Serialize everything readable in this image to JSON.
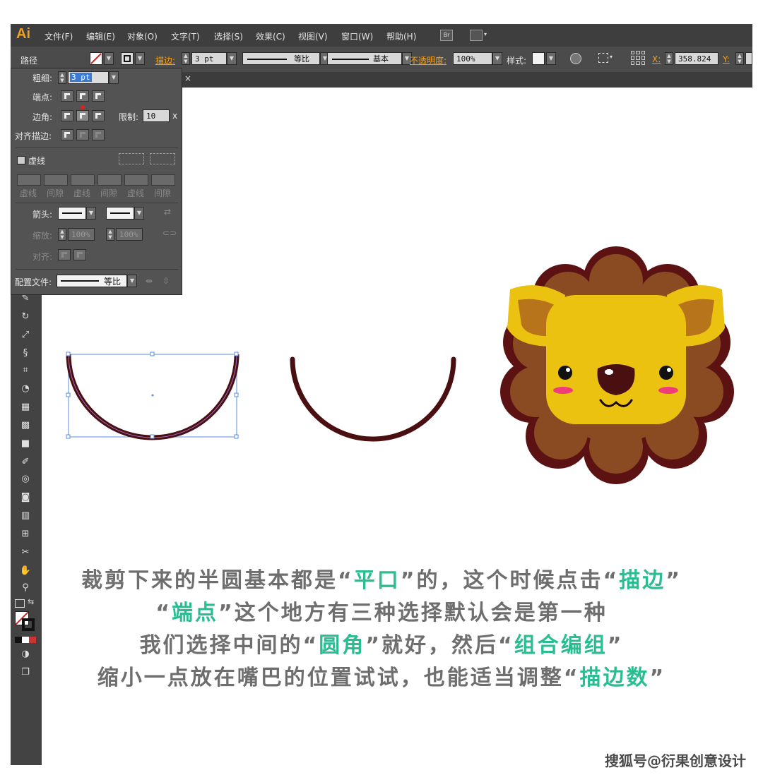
{
  "app": {
    "logo": "Ai",
    "menus": [
      "文件(F)",
      "编辑(E)",
      "对象(O)",
      "文字(T)",
      "选择(S)",
      "效果(C)",
      "视图(V)",
      "窗口(W)",
      "帮助(H)"
    ],
    "bridge_label": "Br"
  },
  "control_bar": {
    "object_type": "路径",
    "stroke_label": "描边:",
    "stroke_weight": "3 pt",
    "profile_label": "等比",
    "brush_label": "基本",
    "opacity_label": "不透明度:",
    "opacity_value": "100%",
    "style_label": "样式:",
    "x_label": "X:",
    "x_value": "358.824",
    "y_label": "Y:"
  },
  "stroke_panel": {
    "weight_label": "粗细:",
    "weight_value": "3 pt",
    "cap_label": "端点:",
    "corner_label": "边角:",
    "limit_label": "限制:",
    "limit_value": "10",
    "limit_unit": "x",
    "align_label": "对齐描边:",
    "dashed_label": "虚线",
    "dash_labels": [
      "虚线",
      "间隙",
      "虚线",
      "间隙",
      "虚线",
      "间隙"
    ],
    "arrow_label": "箭头:",
    "scale_label": "缩放:",
    "scale_start": "100%",
    "scale_end": "100%",
    "align_arrow_label": "对齐:",
    "profile_label": "配置文件:",
    "profile_value": "等比"
  },
  "caption": {
    "line1": [
      {
        "text": "裁剪下来的半圆基本都是“",
        "hl": false
      },
      {
        "text": "平口",
        "hl": true
      },
      {
        "text": "”的，这个时候点击“",
        "hl": false
      },
      {
        "text": "描边",
        "hl": true
      },
      {
        "text": "”",
        "hl": false
      }
    ],
    "line2": [
      {
        "text": "“",
        "hl": false
      },
      {
        "text": "端点",
        "hl": true
      },
      {
        "text": "”这个地方有三种选择默认会是第一种",
        "hl": false
      }
    ],
    "line3": [
      {
        "text": "我们选择中间的“",
        "hl": false
      },
      {
        "text": "圆角",
        "hl": true
      },
      {
        "text": "”就好，然后“",
        "hl": false
      },
      {
        "text": "组合编组",
        "hl": true
      },
      {
        "text": "”",
        "hl": false
      }
    ],
    "line4": [
      {
        "text": "缩小一点放在嘴巴的位置试试，也能适当调整“",
        "hl": false
      },
      {
        "text": "描边数",
        "hl": true
      },
      {
        "text": "”",
        "hl": false
      }
    ]
  },
  "watermark": "搜狐号@衍果创意设计",
  "colors": {
    "accent_orange": "#f0a020",
    "highlight_green": "#2bbd92",
    "stroke_dark": "#4a0f10",
    "lion_yellow": "#ecc211",
    "mane_brown": "#8a4a22",
    "mane_outline": "#5c1212"
  },
  "icons": {
    "tools": [
      "wand-icon",
      "rotate-icon",
      "scale-icon",
      "warp-icon",
      "free-transform-icon",
      "shape-builder-icon",
      "perspective-icon",
      "mesh-icon",
      "gradient-icon",
      "eyedropper-icon",
      "blend-icon",
      "symbol-sprayer-icon",
      "graph-icon",
      "artboard-icon",
      "slice-icon",
      "hand-icon",
      "zoom-icon"
    ]
  }
}
